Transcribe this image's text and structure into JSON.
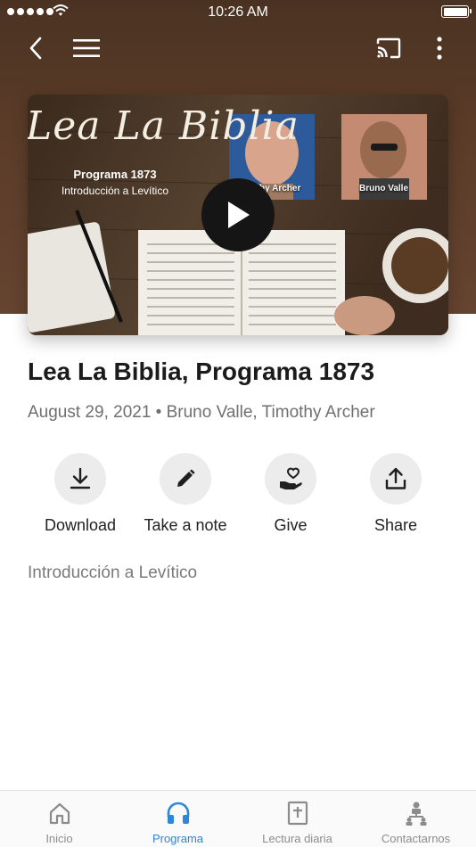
{
  "status_bar": {
    "time": "10:26 AM"
  },
  "header": {
    "back_icon": "chevron-left-icon",
    "menu_icon": "hamburger-icon",
    "cast_icon": "cast-icon",
    "more_icon": "more-vertical-icon"
  },
  "video": {
    "thumbnail_title": "Lea La Biblia",
    "program": "Programa 1873",
    "program_sub": "Introducción a Levítico",
    "host_1": "Timothy Archer",
    "host_2": "Bruno Valle",
    "play_icon": "play-icon"
  },
  "episode": {
    "title": "Lea La Biblia, Programa 1873",
    "meta": "August 29, 2021 • Bruno Valle, Timothy Archer",
    "description": "Introducción a Levítico"
  },
  "actions": [
    {
      "label": "Download",
      "icon": "download-icon"
    },
    {
      "label": "Take a note",
      "icon": "pencil-icon"
    },
    {
      "label": "Give",
      "icon": "give-heart-hand-icon"
    },
    {
      "label": "Share",
      "icon": "share-icon"
    }
  ],
  "tabs": [
    {
      "label": "Inicio",
      "icon": "home-icon",
      "active": false
    },
    {
      "label": "Programa",
      "icon": "headphones-icon",
      "active": true
    },
    {
      "label": "Lectura diaria",
      "icon": "bible-icon",
      "active": false
    },
    {
      "label": "Contactarnos",
      "icon": "org-chart-icon",
      "active": false
    }
  ],
  "colors": {
    "accent": "#2f86d6",
    "header_brown": "#5a3c28",
    "action_circle": "#ececec"
  }
}
